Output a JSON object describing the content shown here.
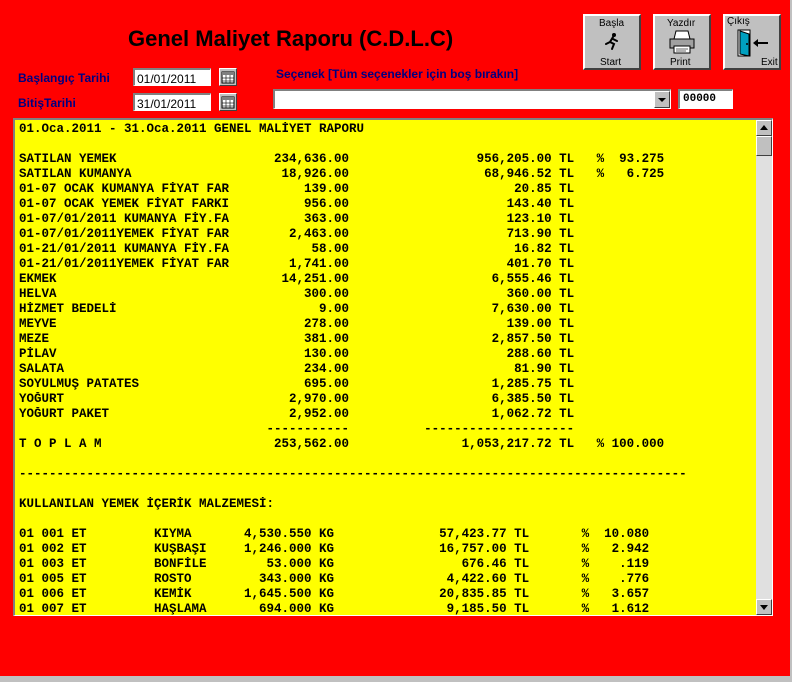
{
  "title": "Genel Maliyet Raporu (C.D.L.C)",
  "start_date": {
    "label": "Başlangıç Tarihi",
    "value": "01/01/2011"
  },
  "end_date": {
    "label": "BitişTarihi",
    "value": "31/01/2011"
  },
  "option": {
    "label": "Seçenek [Tüm seçenekler için boş bırakın]",
    "value": ""
  },
  "code_field": {
    "value": "00000"
  },
  "buttons": {
    "start": {
      "top": "Başla",
      "bottom": "Start"
    },
    "print": {
      "top": "Yazdır",
      "bottom": "Print"
    },
    "exit": {
      "top": "Çıkış",
      "bottom": "Exit"
    }
  },
  "report_lines": [
    "01.Oca.2011 - 31.Oca.2011 GENEL MALİYET RAPORU",
    "",
    "SATILAN YEMEK                     234,636.00                 956,205.00 TL   %  93.275",
    "SATILAN KUMANYA                    18,926.00                  68,946.52 TL   %   6.725",
    "01-07 OCAK KUMANYA FİYAT FAR          139.00                      20.85 TL",
    "01-07 OCAK YEMEK FİYAT FARKI          956.00                     143.40 TL",
    "01-07/01/2011 KUMANYA FİY.FA          363.00                     123.10 TL",
    "01-07/01/2011YEMEK FİYAT FAR        2,463.00                     713.90 TL",
    "01-21/01/2011 KUMANYA FİY.FA           58.00                      16.82 TL",
    "01-21/01/2011YEMEK FİYAT FAR        1,741.00                     401.70 TL",
    "EKMEK                              14,251.00                   6,555.46 TL",
    "HELVA                                 300.00                     360.00 TL",
    "HİZMET BEDELİ                           9.00                   7,630.00 TL",
    "MEYVE                                 278.00                     139.00 TL",
    "MEZE                                  381.00                   2,857.50 TL",
    "PİLAV                                 130.00                     288.60 TL",
    "SALATA                                234.00                      81.90 TL",
    "SOYULMUŞ PATATES                      695.00                   1,285.75 TL",
    "YOĞURT                              2,970.00                   6,385.50 TL",
    "YOĞURT PAKET                        2,952.00                   1,062.72 TL",
    "                                 -----------          --------------------",
    "T O P L A M                       253,562.00               1,053,217.72 TL   % 100.000",
    "",
    "-----------------------------------------------------------------------------------------",
    "",
    "KULLANILAN YEMEK İÇERİK MALZEMESİ:",
    "",
    "01 001 ET         KIYMA       4,530.550 KG              57,423.77 TL       %  10.080",
    "01 002 ET         KUŞBAŞI     1,246.000 KG              16,757.00 TL       %   2.942",
    "01 003 ET         BONFİLE        53.000 KG                 676.46 TL       %    .119",
    "01 005 ET         ROSTO         343.000 KG               4,422.60 TL       %    .776",
    "01 006 ET         KEMİK       1,645.500 KG              20,835.85 TL       %   3.657",
    "01 007 ET         HAŞLAMA       694.000 KG               9,185.50 TL       %   1.612"
  ]
}
